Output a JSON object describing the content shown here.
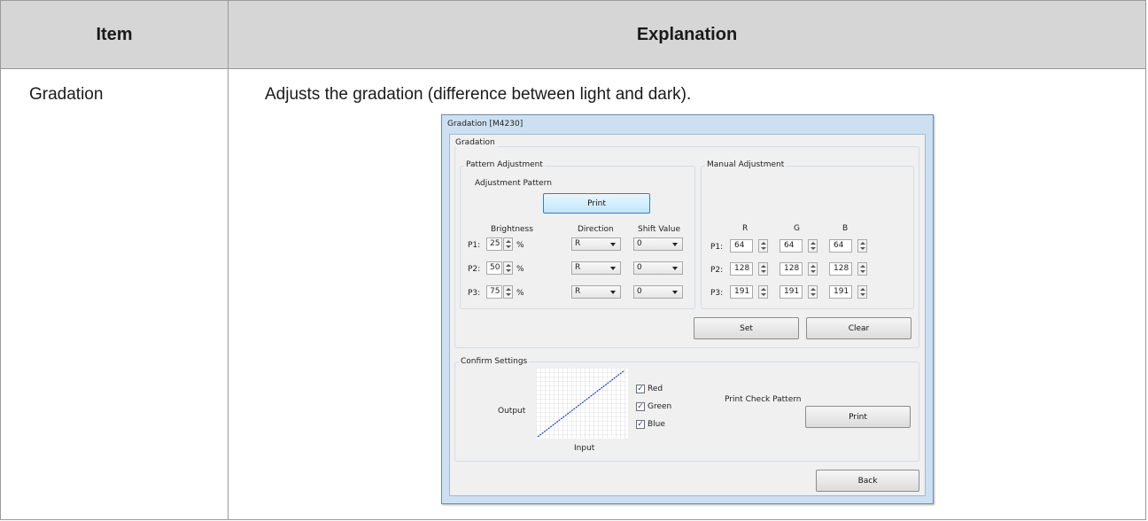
{
  "table": {
    "header_item": "Item",
    "header_explanation": "Explanation",
    "row_item": "Gradation",
    "row_explanation": "Adjusts the gradation (difference between light and dark)."
  },
  "dialog": {
    "title": "Gradation [M4230]",
    "group_gradation": "Gradation",
    "pattern": {
      "label": "Pattern Adjustment",
      "adjustment_pattern_label": "Adjustment Pattern",
      "print_button": "Print",
      "col_brightness": "Brightness",
      "col_direction": "Direction",
      "col_shift": "Shift Value",
      "percent": "%",
      "rows": [
        {
          "label": "P1:",
          "brightness": "25",
          "direction": "R",
          "shift": "0"
        },
        {
          "label": "P2:",
          "brightness": "50",
          "direction": "R",
          "shift": "0"
        },
        {
          "label": "P3:",
          "brightness": "75",
          "direction": "R",
          "shift": "0"
        }
      ]
    },
    "manual": {
      "label": "Manual Adjustment",
      "col_r": "R",
      "col_g": "G",
      "col_b": "B",
      "rows": [
        {
          "label": "P1:",
          "r": "64",
          "g": "64",
          "b": "64"
        },
        {
          "label": "P2:",
          "r": "128",
          "g": "128",
          "b": "128"
        },
        {
          "label": "P3:",
          "r": "191",
          "g": "191",
          "b": "191"
        }
      ]
    },
    "set_button": "Set",
    "clear_button": "Clear",
    "confirm": {
      "label": "Confirm Settings",
      "output_label": "Output",
      "input_label": "Input",
      "red_label": "Red",
      "green_label": "Green",
      "blue_label": "Blue",
      "red_checked": true,
      "green_checked": true,
      "blue_checked": true,
      "print_check_label": "Print Check Pattern",
      "print_button": "Print"
    },
    "back_button": "Back"
  }
}
